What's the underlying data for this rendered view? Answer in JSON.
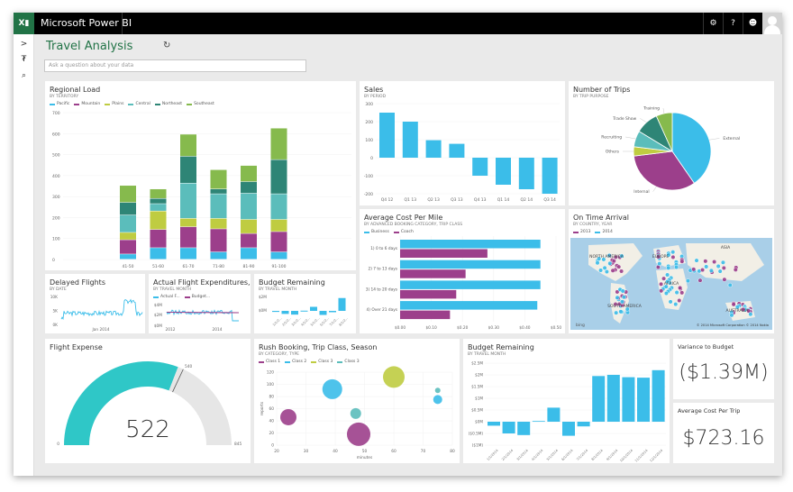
{
  "app": {
    "title": "Microsoft Power BI",
    "logo_icon": "excel-powerbi-logo"
  },
  "topbar": {
    "icons": [
      "gear-icon",
      "help-icon",
      "smiley-feedback-icon"
    ],
    "avatar": "user-avatar"
  },
  "leftnav": {
    "icons": [
      "chevron-right-icon",
      "pin-icon",
      "search-icon"
    ],
    "glyphs": [
      ">",
      "₮",
      "⌕"
    ]
  },
  "dashboard": {
    "title": "Travel Analysis",
    "refresh_icon": "refresh-icon",
    "qa_placeholder": "Ask a question about your data"
  },
  "colors": {
    "accent": "#217346",
    "pacific": "#3bbde9",
    "mountain": "#9c3f8b",
    "plains": "#bfcc41",
    "central": "#5bbdbb",
    "northeast": "#2e8576",
    "southeast": "#86ba4d",
    "gauge_fill": "#2fc7c7",
    "gauge_rest": "#e6e6e6"
  },
  "tiles": {
    "regional_load": {
      "title": "Regional Load",
      "subtitle": "BY TERRITORY"
    },
    "sales": {
      "title": "Sales",
      "subtitle": "BY PERIOD"
    },
    "trips": {
      "title": "Number of Trips",
      "subtitle": "BY TRIP PURPOSE"
    },
    "cost_per_mile": {
      "title": "Average Cost Per Mile",
      "subtitle": "BY ADVANCED BOOKING CATEGORY, TRIP CLASS"
    },
    "on_time": {
      "title": "On Time Arrival",
      "subtitle": "BY COUNTRY, YEAR",
      "legend": [
        "2013",
        "2014"
      ],
      "labels": [
        "NORTH AMERICA",
        "EUROPE",
        "ASIA",
        "AFRICA",
        "SOUTH AMERICA",
        "AUSTRALIA"
      ],
      "copyright": "© 2014 Microsoft Corporation   © 2014 Nokia",
      "bing": "bing"
    },
    "delayed": {
      "title": "Delayed Flights",
      "subtitle": "BY DATE"
    },
    "actual_exp": {
      "title": "Actual Flight Expenditures, Bu...",
      "subtitle": "BY TRAVEL MONTH"
    },
    "budget_small": {
      "title": "Budget Remaining",
      "subtitle": "BY TRAVEL MONTH"
    },
    "flight_expense": {
      "title": "Flight Expense",
      "value": "522",
      "min": "0",
      "max": "845",
      "target": "540"
    },
    "rush": {
      "title": "Rush Booking, Trip Class, Season",
      "subtitle": "BY CATEGORY, TYPE"
    },
    "budget_large": {
      "title": "Budget Remaining",
      "subtitle": "BY TRAVEL MONTH"
    },
    "variance": {
      "title": "Variance to Budget",
      "value": "($1.39M)"
    },
    "avg_trip": {
      "title": "Average Cost Per Trip",
      "value": "$723.16"
    }
  },
  "chart_data": [
    {
      "id": "regional_load",
      "type": "bar",
      "stacked": true,
      "title": "Regional Load",
      "categories": [
        "41-50",
        "51-60",
        "61-70",
        "71-80",
        "81-90",
        "91-100"
      ],
      "series": [
        {
          "name": "Pacific",
          "values": [
            25,
            55,
            55,
            35,
            55,
            35
          ]
        },
        {
          "name": "Mountain",
          "values": [
            68,
            87,
            100,
            110,
            68,
            97
          ]
        },
        {
          "name": "Plains",
          "values": [
            35,
            88,
            40,
            50,
            67,
            58
          ]
        },
        {
          "name": "Central",
          "values": [
            83,
            35,
            168,
            117,
            125,
            122
          ]
        },
        {
          "name": "Northeast",
          "values": [
            60,
            25,
            128,
            23,
            55,
            163
          ]
        },
        {
          "name": "Southeast",
          "values": [
            81,
            45,
            105,
            92,
            77,
            150
          ]
        }
      ],
      "ylim": [
        0,
        700
      ],
      "yticks": [
        0,
        100,
        200,
        300,
        400,
        500,
        600,
        700
      ],
      "legend": "top-left",
      "grid": true
    },
    {
      "id": "sales",
      "type": "bar",
      "title": "Sales",
      "categories": [
        "Q4 12",
        "Q1 13",
        "Q2 13",
        "Q3 13",
        "Q4 13",
        "Q1 14",
        "Q2 14",
        "Q3 14"
      ],
      "values": [
        250,
        200,
        97,
        77,
        -100,
        -150,
        -175,
        -200
      ],
      "ylim": [
        -200,
        300
      ],
      "yticks": [
        -200,
        -100,
        0,
        100,
        200,
        300
      ]
    },
    {
      "id": "trips",
      "type": "pie",
      "title": "Number of Trips",
      "labels": [
        "External",
        "Internal",
        "Others",
        "Recruiting",
        "Trade Show",
        "Training"
      ],
      "values": [
        42,
        34,
        4,
        7,
        10,
        7
      ]
    },
    {
      "id": "cost_per_mile",
      "type": "bar",
      "orientation": "horizontal",
      "title": "Average Cost Per Mile",
      "categories": [
        "1) 0 to 6 days",
        "2) 7 to 13 days",
        "3) 14 to 20 days",
        "4) Over 21 days"
      ],
      "series": [
        {
          "name": "Business",
          "values": [
            0.45,
            0.45,
            0.45,
            0.44
          ]
        },
        {
          "name": "Coach",
          "values": [
            0.28,
            0.21,
            0.18,
            0.16
          ]
        }
      ],
      "xlim": [
        0,
        0.5
      ],
      "xticks": [
        "$0.00",
        "$0.10",
        "$0.20",
        "$0.30",
        "$0.40",
        "$0.50"
      ],
      "legend": "top-left"
    },
    {
      "id": "delayed",
      "type": "line",
      "title": "Delayed Flights",
      "yticks": [
        "0K",
        "5K",
        "10K"
      ],
      "xticks": [
        "Jan 2014"
      ],
      "ylim": [
        0,
        10000
      ]
    },
    {
      "id": "actual_exp",
      "type": "line",
      "title": "Actual Flight Expenditures, Budget",
      "series": [
        {
          "name": "Actual F..."
        },
        {
          "name": "Budget..."
        }
      ],
      "yticks": [
        "$0M",
        "$2M",
        "$4M"
      ],
      "xticks": [
        "2012",
        "2014"
      ]
    },
    {
      "id": "budget_small",
      "type": "bar",
      "title": "Budget Remaining",
      "yticks": [
        "$0M",
        "$2M"
      ],
      "values": [
        -0.15,
        -0.45,
        -0.55,
        0.03,
        0.6,
        -0.6,
        -0.2,
        1.9
      ]
    },
    {
      "id": "flight_expense",
      "type": "gauge",
      "value": 522,
      "min": 0,
      "max": 845,
      "target": 540
    },
    {
      "id": "rush",
      "type": "scatter",
      "title": "Rush Booking, Trip Class, Season",
      "xlabel": "minutes",
      "ylabel": "reports",
      "xlim": [
        20,
        80
      ],
      "ylim": [
        0,
        120
      ],
      "xticks": [
        20,
        30,
        40,
        50,
        60,
        70,
        80
      ],
      "yticks": [
        0,
        20,
        40,
        60,
        80,
        100,
        120
      ],
      "series": [
        {
          "name": "Class 1",
          "points": [
            [
              24,
              46,
              9
            ],
            [
              48,
              18,
              13
            ]
          ]
        },
        {
          "name": "Class 2",
          "points": [
            [
              39,
              92,
              11
            ],
            [
              75,
              75,
              5
            ]
          ]
        },
        {
          "name": "Class 3",
          "points": [
            [
              60,
              112,
              12
            ]
          ]
        },
        {
          "name": "Class 3",
          "points": [
            [
              47,
              52,
              6
            ],
            [
              75,
              90,
              3
            ]
          ]
        }
      ]
    },
    {
      "id": "budget_large",
      "type": "bar",
      "title": "Budget Remaining",
      "categories": [
        "1/1/2014",
        "2/1/2014",
        "3/1/2014",
        "4/1/2014",
        "5/1/2014",
        "6/1/2014",
        "7/1/2014",
        "8/1/2014",
        "9/1/2014",
        "10/1/2014",
        "11/1/2014",
        "12/1/2014"
      ],
      "values": [
        -0.17,
        -0.5,
        -0.57,
        0.03,
        0.6,
        -0.6,
        -0.2,
        1.95,
        2.0,
        1.9,
        1.88,
        2.2
      ],
      "ylim": [
        -1,
        2.5
      ],
      "yticks": [
        "($1M)",
        "($0.5M)",
        "$0M",
        "$0.5M",
        "$1M",
        "$1.5M",
        "$2M",
        "$2.5M"
      ]
    }
  ]
}
